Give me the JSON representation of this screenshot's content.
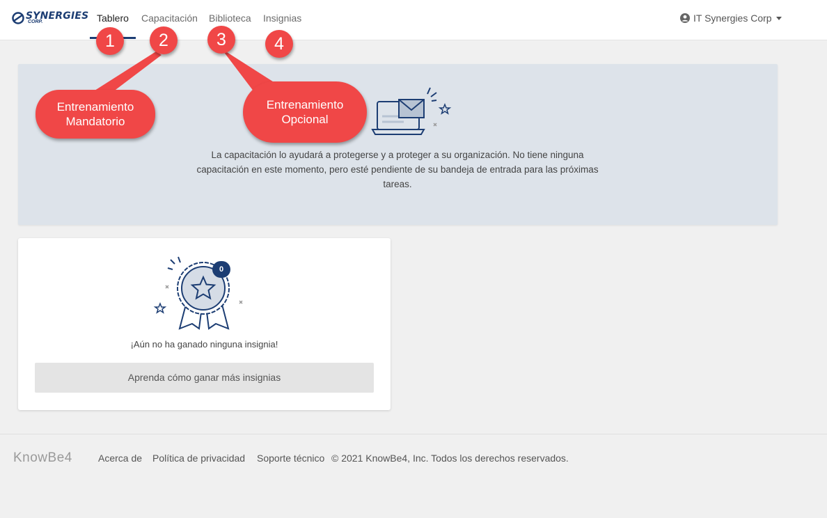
{
  "header": {
    "logo_text": "SYNERGIES",
    "logo_sub": "CORP.",
    "nav": [
      {
        "label": "Tablero",
        "active": true
      },
      {
        "label": "Capacitación",
        "active": false
      },
      {
        "label": "Biblioteca",
        "active": false
      },
      {
        "label": "Insignias",
        "active": false
      }
    ],
    "user_menu": "IT Synergies Corp"
  },
  "annotations": {
    "markers": [
      "1",
      "2",
      "3",
      "4"
    ],
    "callout_mandatory": [
      "Entrenamiento",
      "Mandatorio"
    ],
    "callout_optional": [
      "Entrenamiento",
      "Opcional"
    ],
    "color": "#f04747"
  },
  "training": {
    "message": "La capacitación lo ayudará a protegerse y a proteger a su organización. No tiene ninguna capacitación en este momento, pero esté pendiente de su bandeja de entrada para las próximas tareas."
  },
  "badges": {
    "count": "0",
    "message": "¡Aún no ha ganado ninguna insignia!",
    "button_label": "Aprenda cómo ganar más insignias"
  },
  "footer": {
    "logo": "KnowBe4",
    "links": [
      "Acerca de",
      "Política de privacidad",
      "Soporte técnico"
    ],
    "copyright": "© 2021 KnowBe4, Inc. Todos los derechos reservados."
  },
  "colors": {
    "brand": "#1c3d73",
    "panel": "#dde3ea",
    "background": "#f0f0f0"
  }
}
